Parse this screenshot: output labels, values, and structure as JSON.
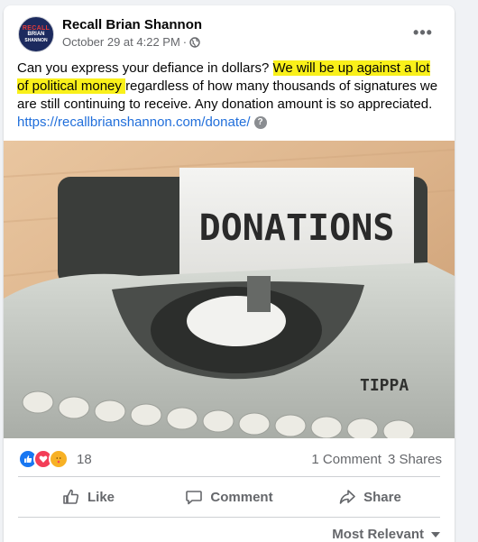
{
  "post": {
    "page_name": "Recall Brian Shannon",
    "avatar": {
      "line1": "RECALL",
      "line2": "BRIAN",
      "line3": "SHANNON"
    },
    "timestamp": "October 29 at 4:22 PM",
    "separator": "·",
    "more_label": "•••",
    "text": {
      "part1": "Can you express your defiance in dollars? ",
      "highlight": "We will be up against a lot of political money ",
      "part2": "regardless of how many thousands of signatures we are still continuing to receive. Any donation amount is so appreciated. ",
      "link": "https://recallbrianshannon.com/donate/",
      "help_icon": "?"
    },
    "image_text": "DONATIONS",
    "typewriter_brand": "TIPPA"
  },
  "stats": {
    "reaction_count": "18",
    "comments": "1 Comment",
    "shares": "3 Shares",
    "reactions": [
      "like-icon",
      "love-icon",
      "care-icon"
    ]
  },
  "actions": {
    "like": "Like",
    "comment": "Comment",
    "share": "Share"
  },
  "sort": {
    "label": "Most Relevant"
  },
  "colors": {
    "highlight": "#f9f01a",
    "link": "#216fdb",
    "like_blue": "#1877f2",
    "love_red": "#f33e58",
    "care_yellow": "#f7b125"
  }
}
